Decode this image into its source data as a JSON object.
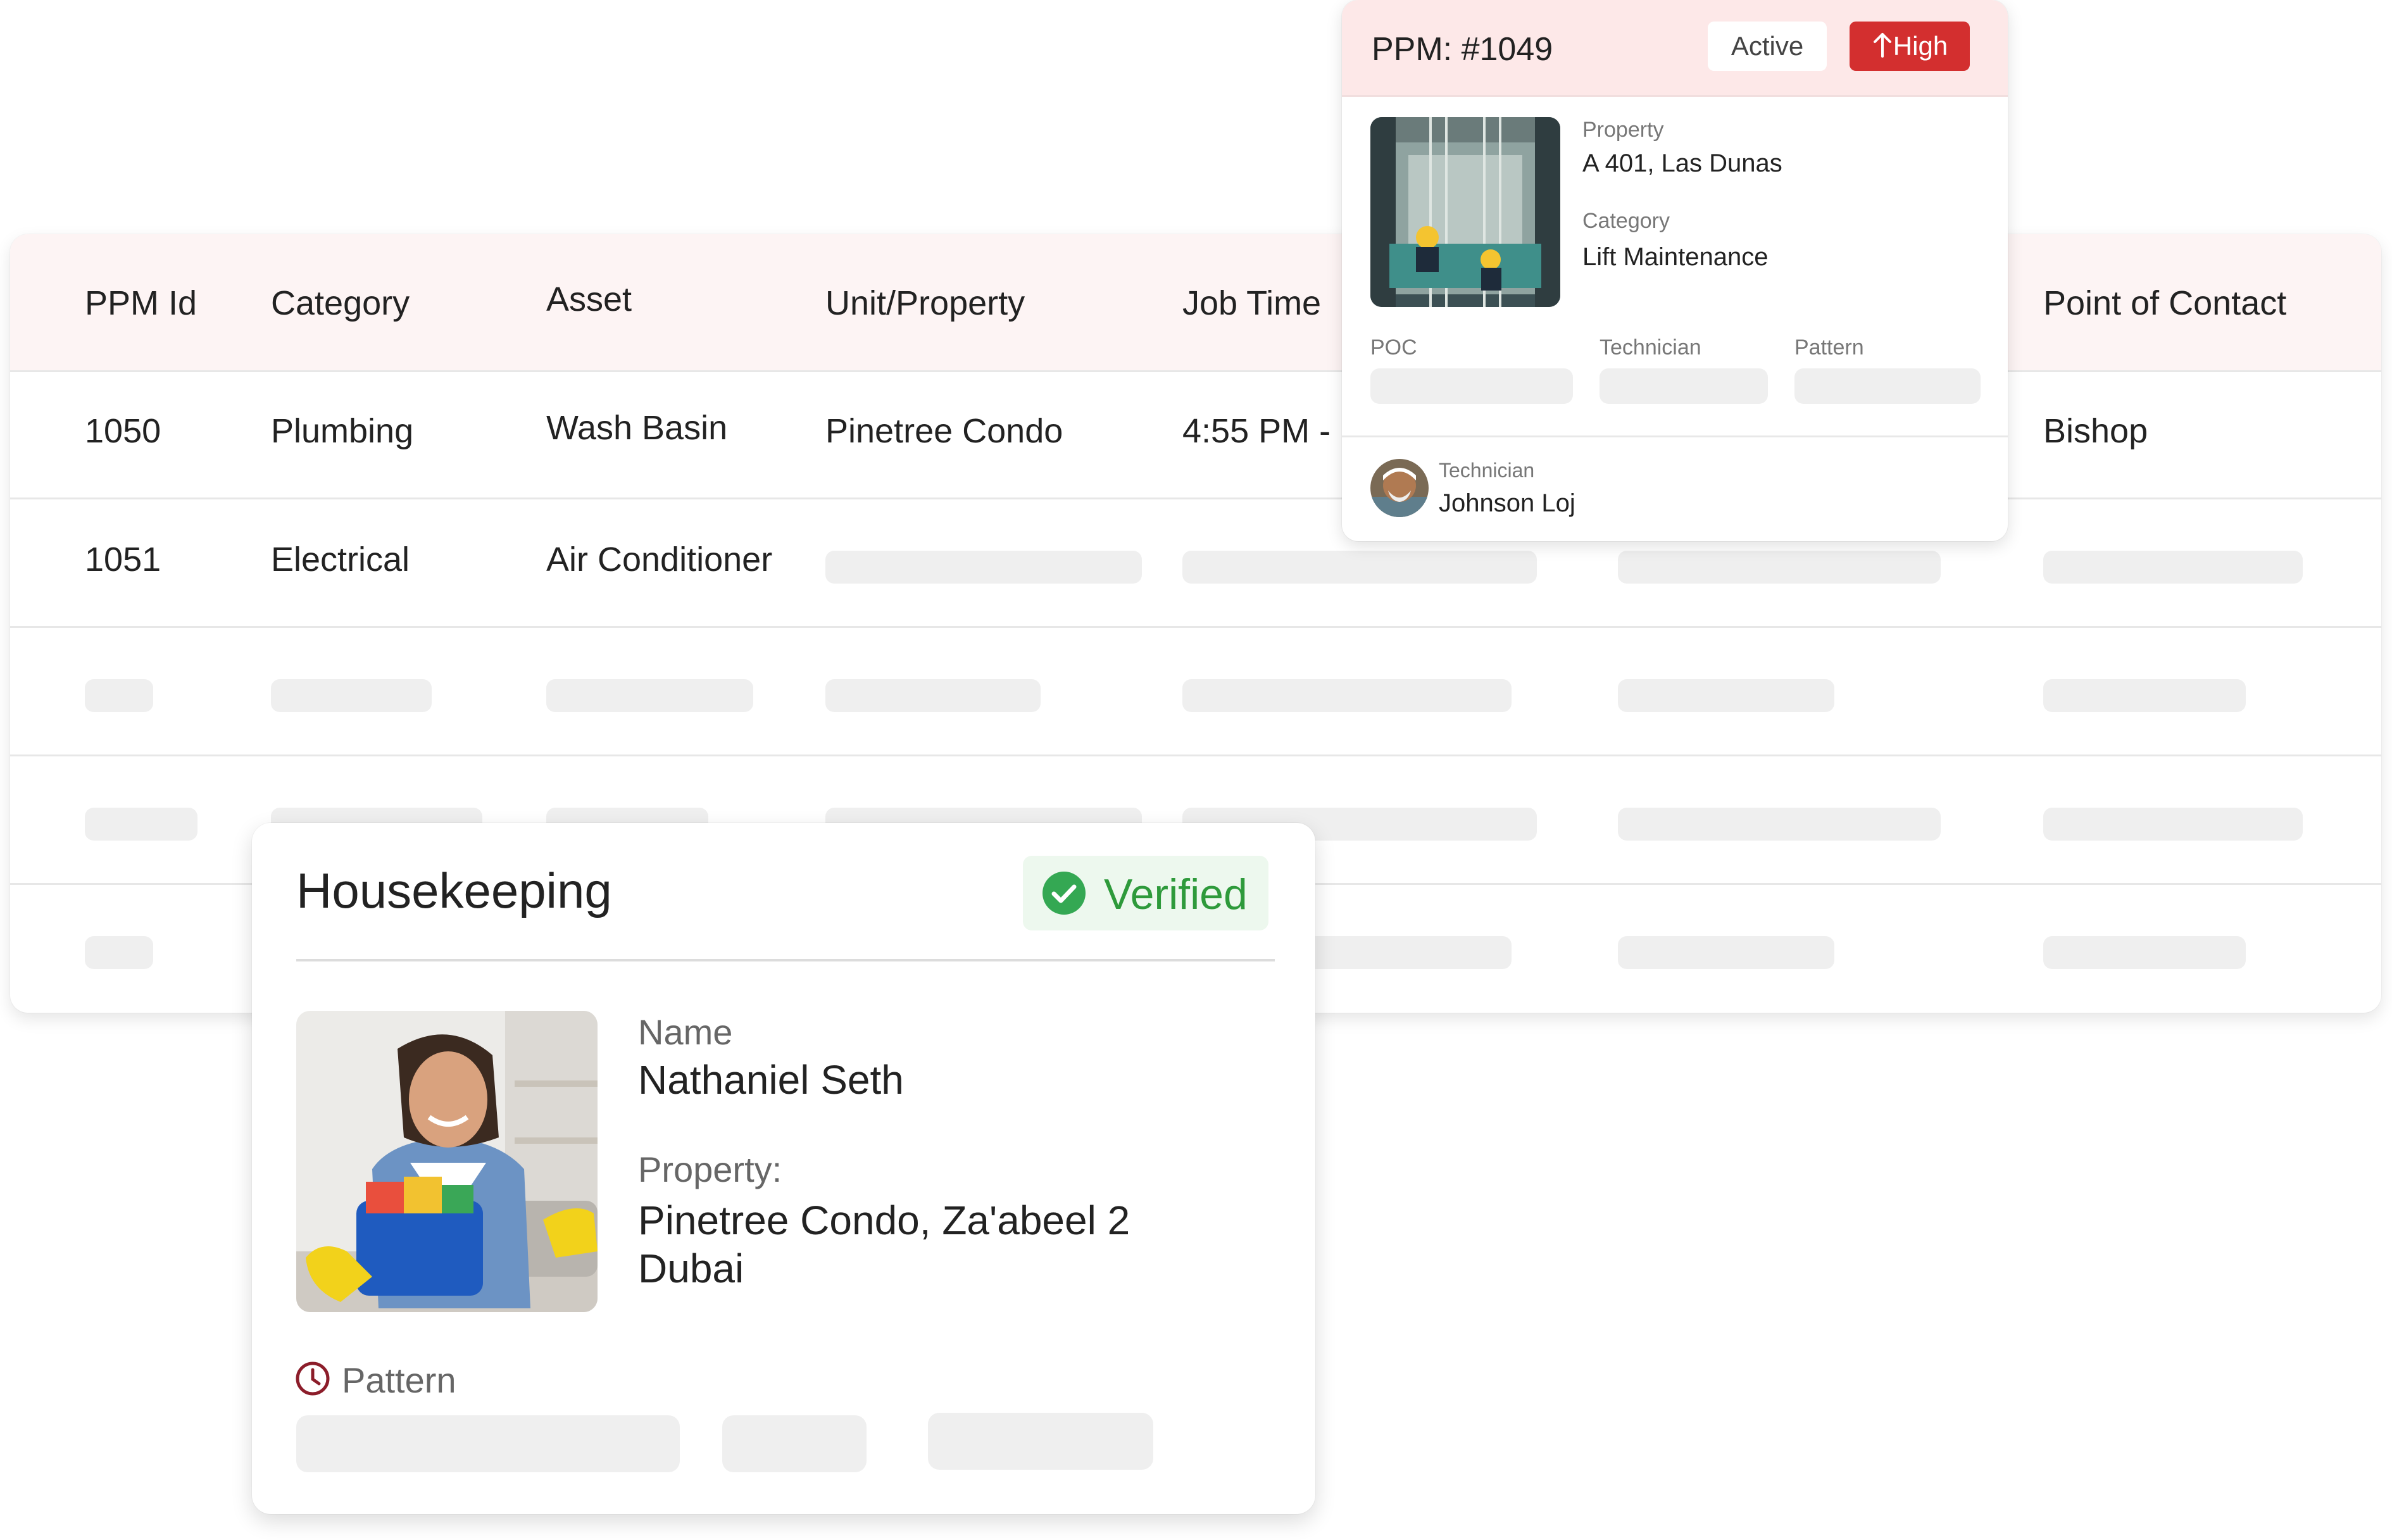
{
  "table": {
    "headers": [
      "PPM Id",
      "Category",
      "Asset",
      "Unit/Property",
      "Job Time",
      "Point of Contact"
    ],
    "rows": [
      {
        "id": "1050",
        "category": "Plumbing",
        "asset": "Wash Basin",
        "property": "Pinetree Condo",
        "job_time": "4:55 PM -",
        "contact": "Bishop"
      },
      {
        "id": "1051",
        "category": "Electrical",
        "asset": "Air Conditioner"
      }
    ]
  },
  "ppm_card": {
    "title": "PPM: #1049",
    "status": "Active",
    "priority": "High",
    "priority_icon": "arrow-up-icon",
    "property_label": "Property",
    "property_value": "A 401, Las Dunas",
    "category_label": "Category",
    "category_value": "Lift Maintenance",
    "poc_label": "POC",
    "technician_label": "Technician",
    "pattern_label": "Pattern",
    "assigned_label": "Technician",
    "assigned_name": "Johnson Loj"
  },
  "housekeeping_card": {
    "title": "Housekeeping",
    "status": "Verified",
    "status_icon": "check-circle-icon",
    "name_label": "Name",
    "name_value": "Nathaniel Seth",
    "property_label": "Property:",
    "property_line1": "Pinetree Condo, Za'abeel 2",
    "property_line2": "Dubai",
    "pattern_label": "Pattern",
    "pattern_icon": "clock-icon"
  },
  "colors": {
    "accent_red": "#d32f2f",
    "header_tint": "#fdf4f4",
    "verified_green": "#2e9a3b",
    "skeleton": "#efefef"
  }
}
